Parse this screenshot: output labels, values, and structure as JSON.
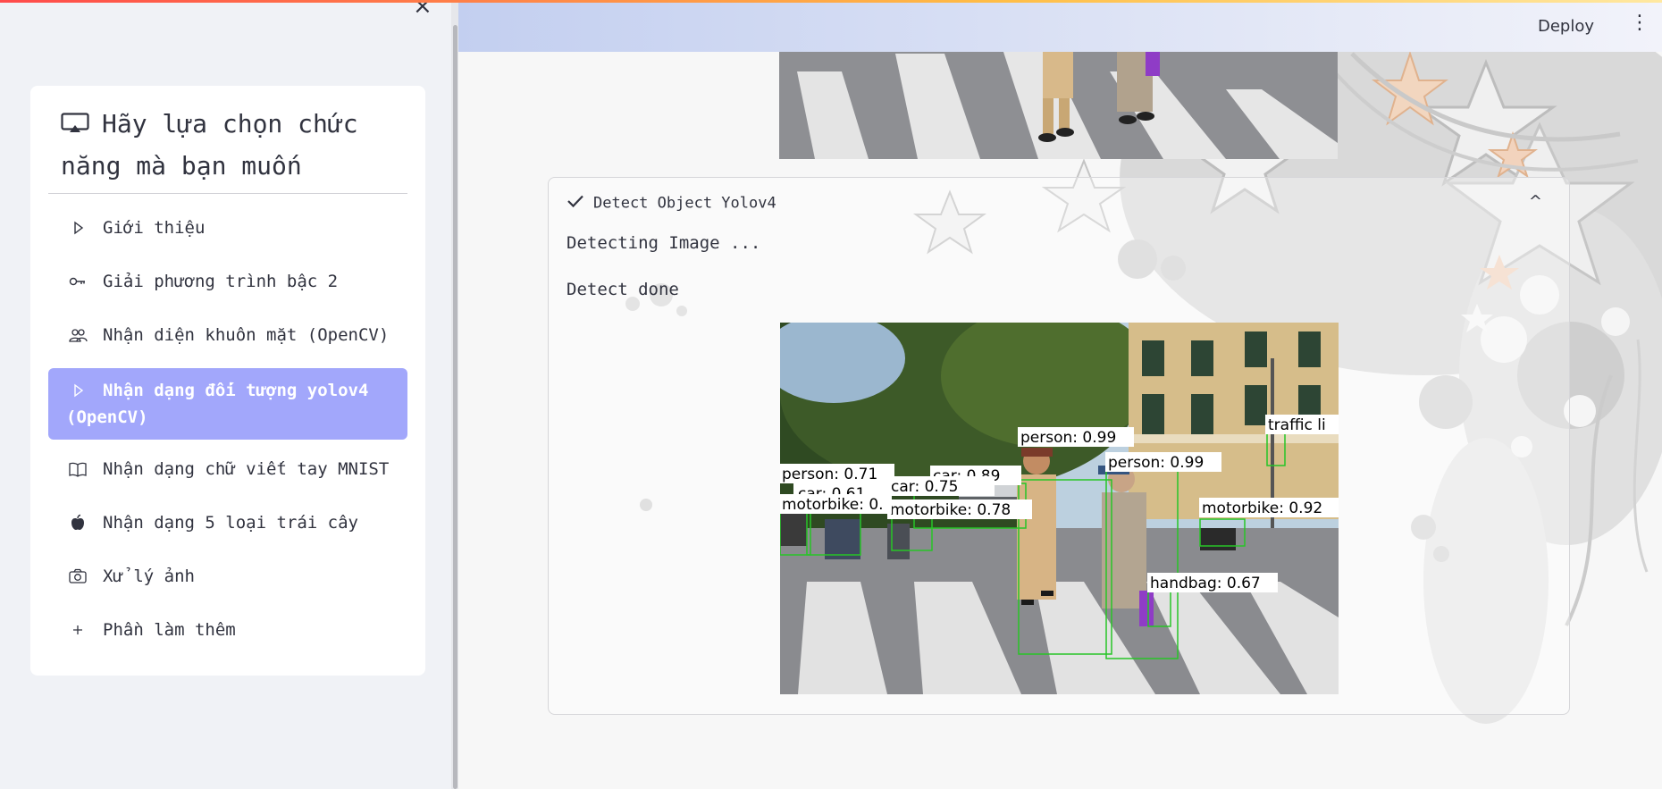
{
  "sidebar": {
    "close_icon": "close-icon",
    "header": "Hãy lựa chọn chức năng mà bạn muốn",
    "header_icon": "airplay-icon",
    "items": [
      {
        "label": "Giới thiệu",
        "icon": "play-icon"
      },
      {
        "label": "Giải phương trình bậc 2",
        "icon": "key-icon"
      },
      {
        "label": "Nhận diện khuôn mặt (OpenCV)",
        "icon": "people-icon"
      },
      {
        "label": "Nhận dạng đối tượng yolov4 (OpenCV)",
        "icon": "play-icon",
        "active": true
      },
      {
        "label": "Nhận dạng chữ viết tay MNIST",
        "icon": "book-icon"
      },
      {
        "label": "Nhận dạng 5 loại trái cây",
        "icon": "apple-icon"
      },
      {
        "label": "Xử lý ảnh",
        "icon": "camera-icon"
      },
      {
        "label": "Phần làm thêm",
        "icon": "plus-icon"
      }
    ],
    "active_color": "#a2a7fb"
  },
  "topbar": {
    "deploy_label": "Deploy",
    "menu_icon": "kebab-icon"
  },
  "expander": {
    "title": "Detect Object Yolov4",
    "status_detecting": "Detecting Image ...",
    "status_done": "Detect done"
  },
  "detections": [
    {
      "label": "person: 0.99"
    },
    {
      "label": "person: 0.99"
    },
    {
      "label": "person: 0.71"
    },
    {
      "label": "car: 0.89"
    },
    {
      "label": "car: 0.75"
    },
    {
      "label": "car: 0.61"
    },
    {
      "label": "motorbike: 0.78"
    },
    {
      "label": "motorbike: 0.92"
    },
    {
      "label": "motorbike: 0."
    },
    {
      "label": "handbag: 0.67"
    },
    {
      "label": "traffic li"
    }
  ],
  "colors": {
    "accent": "#ff4b4b",
    "box": "#27c527",
    "text": "#31333f"
  }
}
